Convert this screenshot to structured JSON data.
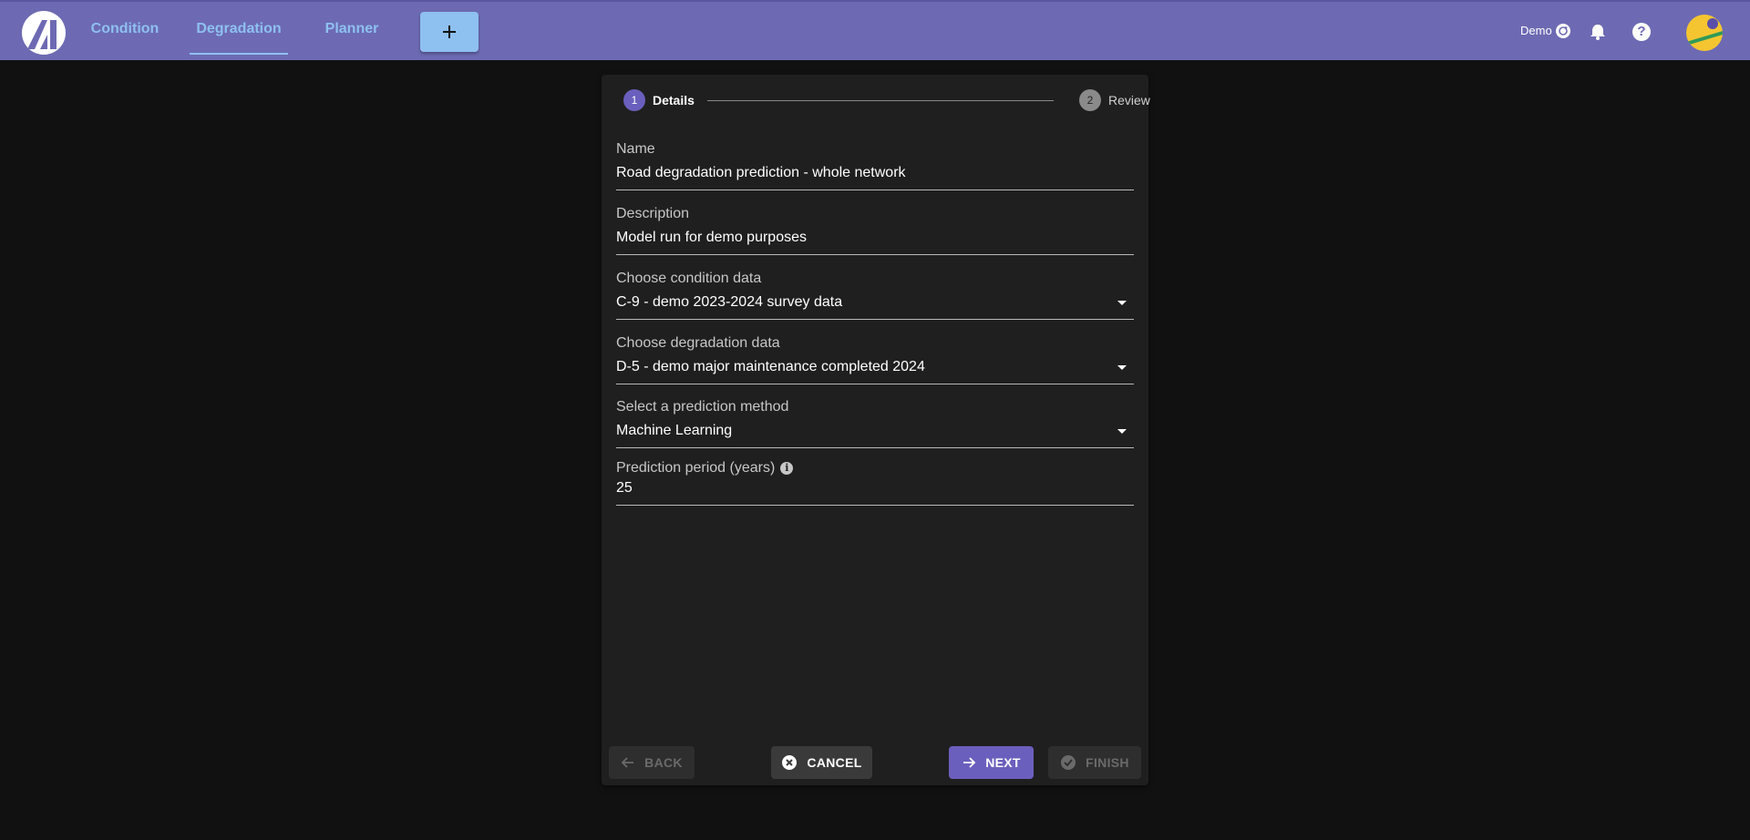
{
  "nav": {
    "tabs": [
      {
        "label": "Condition"
      },
      {
        "label": "Degradation"
      },
      {
        "label": "Planner"
      }
    ],
    "active_tab": "Degradation",
    "add_icon": "plus-icon"
  },
  "header_right": {
    "demo_label": "Demo",
    "icons": [
      "sync-icon",
      "bell-icon",
      "help-icon",
      "avatar"
    ]
  },
  "stepper": {
    "steps": [
      {
        "number": "1",
        "label": "Details"
      },
      {
        "number": "2",
        "label": "Review"
      }
    ],
    "current": 1
  },
  "form": {
    "name": {
      "label": "Name",
      "value": "Road degradation prediction - whole network"
    },
    "description": {
      "label": "Description",
      "value": "Model run for demo purposes"
    },
    "condition_data": {
      "label": "Choose condition data",
      "value": "C-9 - demo 2023-2024 survey data"
    },
    "degradation_data": {
      "label": "Choose degradation data",
      "value": "D-5 - demo major maintenance completed 2024"
    },
    "prediction_method": {
      "label": "Select a prediction method",
      "value": "Machine Learning"
    },
    "prediction_period": {
      "label": "Prediction period (years)",
      "value": "25"
    }
  },
  "buttons": {
    "back": "BACK",
    "cancel": "CANCEL",
    "next": "NEXT",
    "finish": "FINISH"
  },
  "colors": {
    "topbar": "#6d6ab3",
    "accent": "#6a5fbd",
    "nav_text": "#8ec0f0",
    "background": "#111111",
    "card": "#1f1f1f"
  }
}
